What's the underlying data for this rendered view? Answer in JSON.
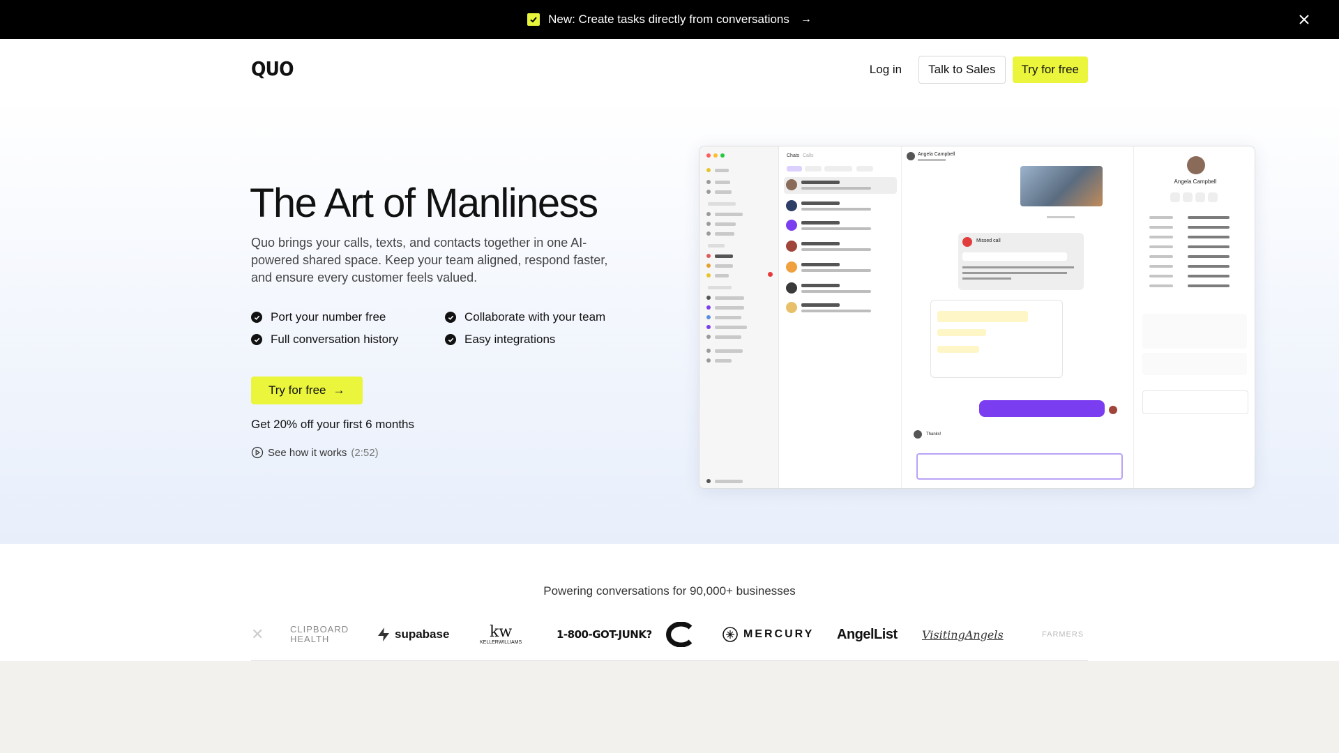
{
  "announcement": {
    "text": "New: Create tasks directly from conversations",
    "arrow": "→",
    "close": "✕"
  },
  "header": {
    "logo": "QUO",
    "login": "Log in",
    "talk_to_sales": "Talk to Sales",
    "try_free": "Try for free"
  },
  "hero": {
    "title": "The Art of Manliness",
    "subtitle": "Quo brings your calls, texts, and contacts together in one AI-powered shared space. Keep your team aligned, respond faster, and ensure every customer feels valued.",
    "features": [
      "Port your number free",
      "Collaborate with your team",
      "Full conversation history",
      "Easy integrations"
    ],
    "cta": "Try for free",
    "cta_arrow": "→",
    "discount": "Get 20% off your first 6 months",
    "watch_label": "See how it works",
    "watch_duration": "(2:52)"
  },
  "mockup": {
    "contact_name": "Angela Campbell",
    "tabs": [
      "Chats",
      "Calls"
    ],
    "missed_call": "Missed call",
    "reply_thanks": "Thanks!"
  },
  "logos": {
    "caption": "Powering conversations for 90,000+ businesses",
    "items": [
      "CLIPBOARD HEALTH",
      "supabase",
      "KELLERWILLIAMS",
      "1-800-GOT-JUNK?",
      "MERCURY",
      "AngelList",
      "VisitingAngels",
      "FARMERS"
    ],
    "kw": "kw"
  },
  "colors": {
    "accent": "#eaf53b",
    "dark": "#000000",
    "purple": "#7b3df0"
  }
}
